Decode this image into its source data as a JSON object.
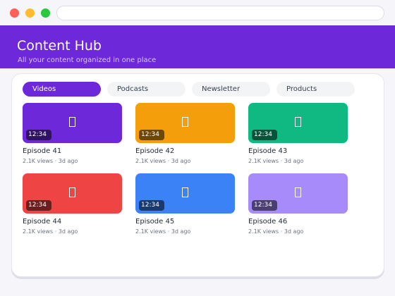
{
  "window": {
    "controls": [
      "close",
      "minimize",
      "maximize"
    ],
    "address": ""
  },
  "header": {
    "title": "Content Hub",
    "subtitle": "All your content organized in one place",
    "color": "#6d28d9"
  },
  "tabs": [
    {
      "label": "Videos",
      "active": true
    },
    {
      "label": "Podcasts",
      "active": false
    },
    {
      "label": "Newsletter",
      "active": false
    },
    {
      "label": "Products",
      "active": false
    }
  ],
  "videos": [
    {
      "title": "Episode 41",
      "meta": "2.1K views · 3d ago",
      "duration": "12:34",
      "color": "#6d28d9",
      "icon": "play-icon"
    },
    {
      "title": "Episode 42",
      "meta": "2.1K views · 3d ago",
      "duration": "12:34",
      "color": "#f59e0b",
      "icon": "play-icon"
    },
    {
      "title": "Episode 43",
      "meta": "2.1K views · 3d ago",
      "duration": "12:34",
      "color": "#10b981",
      "icon": "play-icon"
    },
    {
      "title": "Episode 44",
      "meta": "2.1K views · 3d ago",
      "duration": "12:34",
      "color": "#ef4444",
      "icon": "play-icon"
    },
    {
      "title": "Episode 45",
      "meta": "2.1K views · 3d ago",
      "duration": "12:34",
      "color": "#3b82f6",
      "icon": "play-icon"
    },
    {
      "title": "Episode 46",
      "meta": "2.1K views · 3d ago",
      "duration": "12:34",
      "color": "#a78bfa",
      "icon": "play-icon"
    }
  ]
}
